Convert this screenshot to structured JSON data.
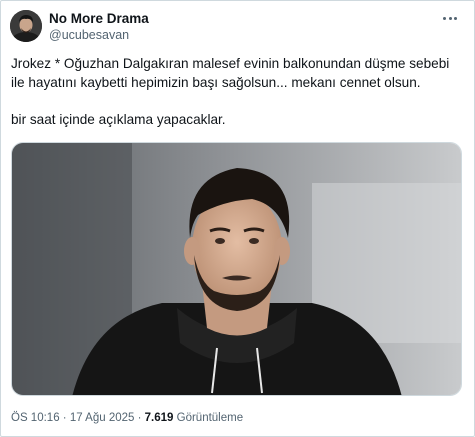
{
  "author": {
    "display_name": "No More Drama",
    "handle": "@ucubesavan"
  },
  "post": {
    "line1": "Jrokez * Oğuzhan Dalgakıran malesef evinin balkonundan düşme sebebi",
    "line2": "ile hayatını kaybetti hepimizin başı sağolsun... mekanı cennet olsun.",
    "line3": "bir saat içinde açıklama yapacaklar."
  },
  "meta": {
    "time": "ÖS 10:16",
    "sep1": " · ",
    "date": "17 Ağu 2025",
    "sep2": " · ",
    "views_count": "7.619",
    "views_label": " Görüntüleme"
  },
  "icons": {
    "more": "more-horizontal-icon"
  }
}
